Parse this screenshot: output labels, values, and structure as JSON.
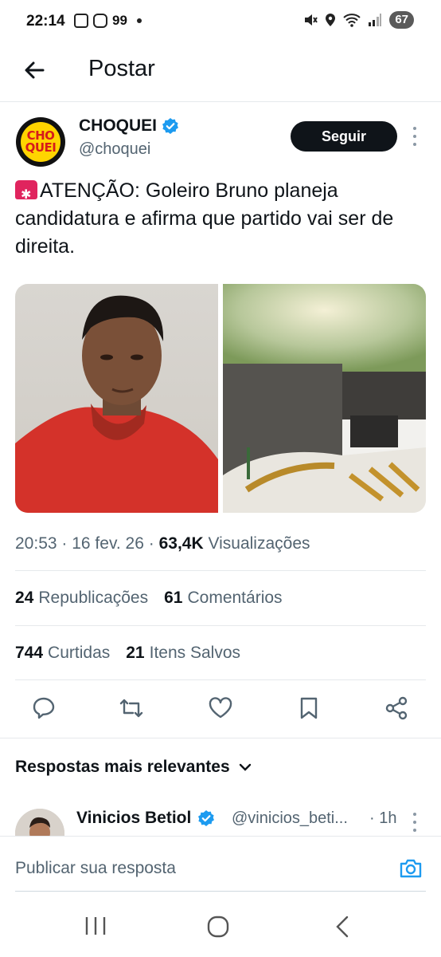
{
  "status_bar": {
    "time": "22:14",
    "notif_count": "99",
    "battery": "67"
  },
  "header": {
    "title": "Postar"
  },
  "post": {
    "author_name": "CHOQUEI",
    "author_handle": "@choquei",
    "avatar_text_top": "CHO",
    "avatar_text_bottom": "QUEI",
    "follow_label": "Seguir",
    "text": "ATENÇÃO: Goleiro Bruno planeja candidatura e afirma que partido vai ser de direita.",
    "time": "20:53",
    "date": "16 fev. 26",
    "views_count": "63,4K",
    "views_label": "Visualizações",
    "reposts_count": "24",
    "reposts_label": "Republicações",
    "comments_count": "61",
    "comments_label": "Comentários",
    "likes_count": "744",
    "likes_label": "Curtidas",
    "saves_count": "21",
    "saves_label": "Itens Salvos"
  },
  "replies": {
    "section_label": "Respostas mais relevantes",
    "first": {
      "name": "Vinicios Betiol",
      "handle": "@vinicios_beti...",
      "time": "· 1h"
    }
  },
  "composer": {
    "placeholder": "Publicar sua resposta"
  },
  "colors": {
    "verified": "#1d9bf0",
    "text_primary": "#0f1419",
    "text_secondary": "#536471",
    "follow_bg": "#0f1419"
  }
}
